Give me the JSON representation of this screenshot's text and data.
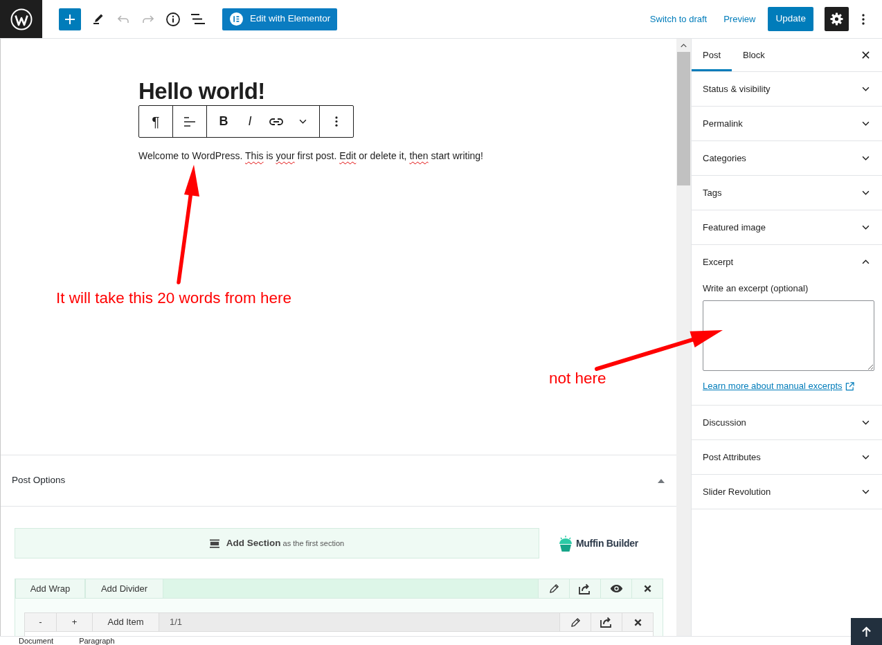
{
  "top_bar": {
    "tools": [
      {
        "kind": "add",
        "disabled": false
      },
      {
        "kind": "edit",
        "disabled": false
      },
      {
        "kind": "undo",
        "disabled": true
      },
      {
        "kind": "redo",
        "disabled": true
      },
      {
        "kind": "info",
        "disabled": false
      },
      {
        "kind": "outline",
        "disabled": false
      }
    ],
    "elementor_button": "Edit with Elementor",
    "actions": [
      {
        "kind": "link",
        "label": "Switch to draft"
      },
      {
        "kind": "link",
        "label": "Preview"
      },
      {
        "kind": "primary",
        "label": "Update"
      }
    ],
    "settings": {
      "selected": true
    }
  },
  "editor": {
    "title": "Hello world!",
    "block_toolbar": [
      {
        "tools": [
          {
            "kind": "paragraph",
            "label": "¶"
          }
        ]
      },
      {
        "tools": [
          {
            "kind": "align"
          }
        ]
      },
      {
        "tools": [
          {
            "kind": "bold",
            "label": "B"
          },
          {
            "kind": "italic",
            "label": "I"
          },
          {
            "kind": "link"
          },
          {
            "kind": "more"
          }
        ]
      },
      {
        "tools": [
          {
            "kind": "options"
          }
        ]
      }
    ],
    "paragraph": [
      {
        "text": "Welcome to WordPress. ",
        "misspelled": false
      },
      {
        "text": "This",
        "misspelled": true
      },
      {
        "text": " is ",
        "misspelled": false
      },
      {
        "text": "your",
        "misspelled": true
      },
      {
        "text": " first post. ",
        "misspelled": false
      },
      {
        "text": "Edit",
        "misspelled": true
      },
      {
        "text": " or delete it, ",
        "misspelled": false
      },
      {
        "text": "then",
        "misspelled": true
      },
      {
        "text": " start writing!",
        "misspelled": false
      }
    ]
  },
  "post_options": {
    "title": "Post Options",
    "expanded": true,
    "add_section": "**Add Section** as the first section",
    "brand": "Muffin Builder",
    "wrap": {
      "buttons": [
        "Add Wrap",
        "Add Divider"
      ],
      "tools": [
        {
          "kind": "edit"
        },
        {
          "kind": "export"
        },
        {
          "kind": "view"
        },
        {
          "kind": "delete"
        }
      ]
    },
    "item": {
      "buttons": [
        "-",
        "+",
        "Add Item"
      ],
      "count": "1/1",
      "tools": [
        {
          "kind": "edit"
        },
        {
          "kind": "export"
        },
        {
          "kind": "delete"
        }
      ]
    }
  },
  "sidebar": {
    "tabs": [
      {
        "label": "Post",
        "selected": true
      },
      {
        "label": "Block",
        "selected": false
      }
    ],
    "panels": [
      {
        "title": "Status & visibility",
        "expanded": false
      },
      {
        "title": "Permalink",
        "expanded": false
      },
      {
        "title": "Categories",
        "expanded": false
      },
      {
        "title": "Tags",
        "expanded": false
      },
      {
        "title": "Featured image",
        "expanded": false
      },
      {
        "title": "Excerpt",
        "expanded": true,
        "field_label": "Write an excerpt (optional)",
        "link": "Learn more about manual excerpts"
      },
      {
        "title": "Discussion",
        "expanded": false
      },
      {
        "title": "Post Attributes",
        "expanded": false
      },
      {
        "title": "Slider Revolution",
        "expanded": false
      }
    ]
  },
  "status_bar": {
    "breadcrumbs": [
      "Document",
      "Paragraph"
    ]
  },
  "annotations": [
    {
      "text": "It will take this 20 words from here"
    },
    {
      "text": "not here"
    }
  ]
}
